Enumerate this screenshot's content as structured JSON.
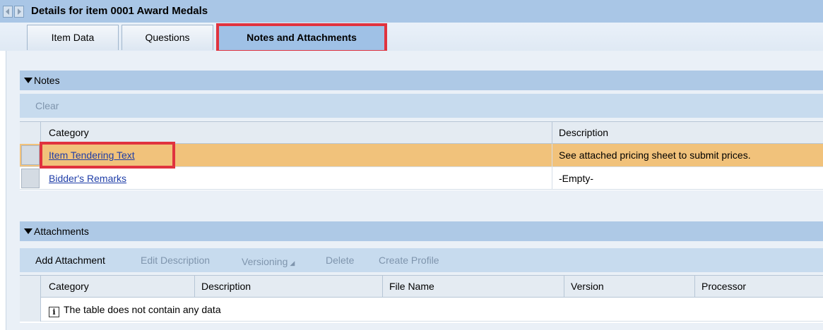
{
  "window": {
    "title": "Details for item 0001 Award Medals"
  },
  "nav": {
    "back_icon": "chevron-left-icon",
    "forward_icon": "chevron-right-icon"
  },
  "tabs": [
    {
      "label": "Item Data",
      "active": false
    },
    {
      "label": "Questions",
      "active": false
    },
    {
      "label": "Notes and Attachments",
      "active": true
    }
  ],
  "notes": {
    "header": "Notes",
    "toolbar": {
      "clear_label": "Clear"
    },
    "columns": [
      "Category",
      "Description"
    ],
    "rows": [
      {
        "category": "Item Tendering Text",
        "description": "See attached pricing sheet to submit prices.",
        "selected": true
      },
      {
        "category": "Bidder's Remarks",
        "description": "-Empty-",
        "selected": false
      }
    ]
  },
  "attachments": {
    "header": "Attachments",
    "toolbar": {
      "add": "Add Attachment",
      "edit": "Edit Description",
      "versioning": "Versioning",
      "delete": "Delete",
      "create_profile": "Create Profile"
    },
    "columns": [
      "Category",
      "Description",
      "File Name",
      "Version",
      "Processor"
    ],
    "empty_message": "The table does not contain any data",
    "empty_icon": "info-icon"
  },
  "colors": {
    "titlebar": "#a9c6e6",
    "section_header": "#aec9e6",
    "toolbar": "#c7dbee",
    "selected_row": "#f1c27b",
    "highlight_box": "#e0333f",
    "link": "#1f3ea8"
  }
}
